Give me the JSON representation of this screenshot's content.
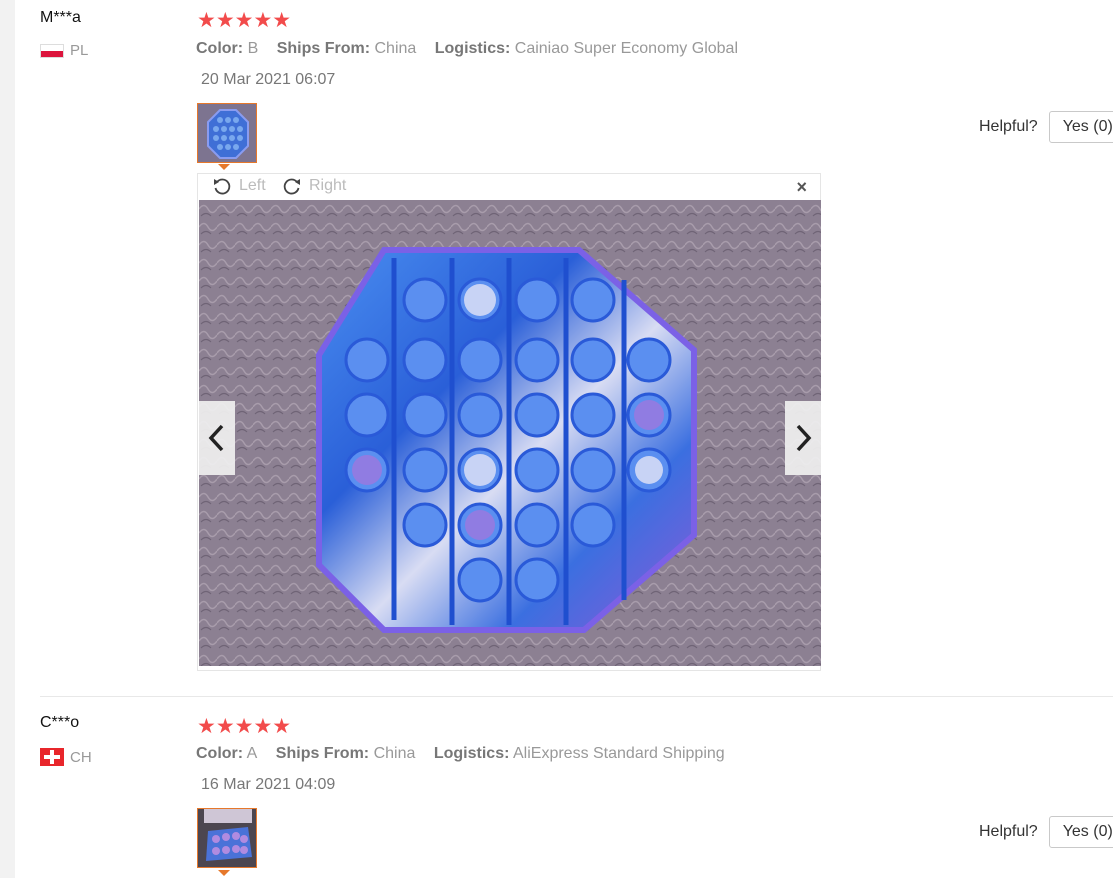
{
  "reviews": [
    {
      "user": "M***a",
      "country": "PL",
      "rating": "★★★★★",
      "attributes": [
        {
          "label": "Color:",
          "value": "B"
        },
        {
          "label": "Ships From:",
          "value": "China"
        },
        {
          "label": "Logistics:",
          "value": "Cainiao Super Economy Global"
        }
      ],
      "date": "20 Mar 2021 06:07",
      "helpful_label": "Helpful?",
      "yes_label": "Yes (0)",
      "viewer": {
        "rotate_left": "Left",
        "rotate_right": "Right",
        "close": "×"
      }
    },
    {
      "user": "C***o",
      "country": "CH",
      "rating": "★★★★★",
      "attributes": [
        {
          "label": "Color:",
          "value": "A"
        },
        {
          "label": "Ships From:",
          "value": "China"
        },
        {
          "label": "Logistics:",
          "value": "AliExpress Standard Shipping"
        }
      ],
      "date": "16 Mar 2021 04:09",
      "helpful_label": "Helpful?",
      "yes_label": "Yes (0)"
    }
  ],
  "colors": {
    "star": "#f24b4b",
    "thumb_border": "#e6782b",
    "muted_text": "#999999"
  },
  "icons": {
    "rotate_left": "rotate-left-icon",
    "rotate_right": "rotate-right-icon",
    "prev": "chevron-left-icon",
    "next": "chevron-right-icon",
    "close": "close-icon"
  }
}
